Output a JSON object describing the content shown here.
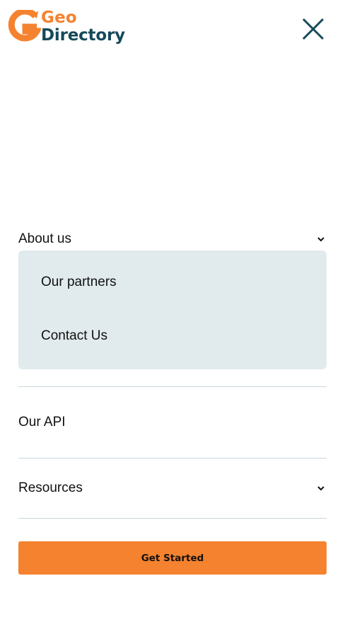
{
  "header": {
    "logo_top": "Geo",
    "logo_bottom": "Directory",
    "close_icon": "close-icon"
  },
  "colors": {
    "brand_orange": "#f5822f",
    "brand_teal": "#15495a",
    "submenu_bg": "#e1eaed",
    "divider": "#c7d7dc"
  },
  "menu": {
    "about": {
      "label": "About us",
      "icon": "chevron-down-icon",
      "expanded": true,
      "children": [
        {
          "label": "Our partners"
        },
        {
          "label": "Contact Us"
        }
      ]
    },
    "api": {
      "label": "Our API"
    },
    "resources": {
      "label": "Resources",
      "icon": "chevron-down-icon",
      "expanded": false
    }
  },
  "cta": {
    "label": "Get Started"
  }
}
